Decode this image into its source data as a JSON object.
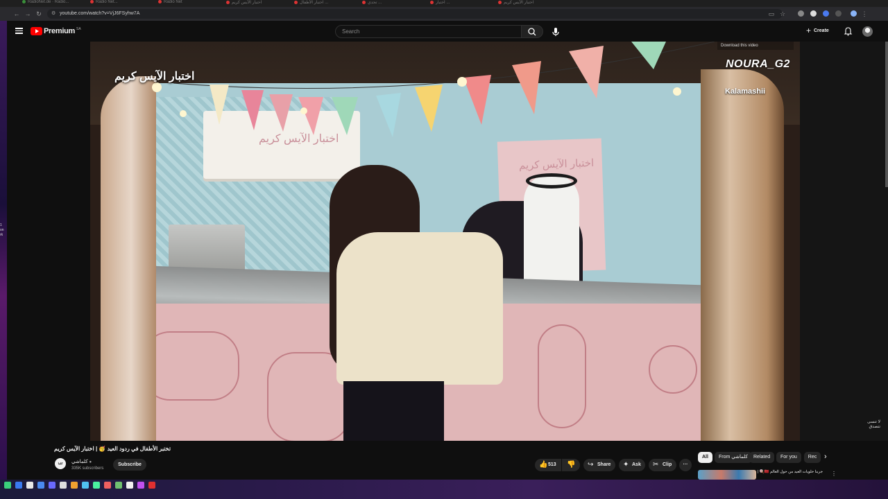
{
  "browser": {
    "url": "youtube.com/watch?v=VjJ6FSyhw7A",
    "tabs": [
      {
        "label": "RadioNet.de · Radio..."
      },
      {
        "label": "Radio Net..."
      },
      {
        "label": "Radio Net"
      },
      {
        "label": "اختبار الآيس كريم"
      },
      {
        "label": "اختبار الأطفال ..."
      },
      {
        "label": "تحدي ..."
      },
      {
        "label": "اختبار ..."
      },
      {
        "label": "اختبار الآيس كريم"
      }
    ]
  },
  "header": {
    "logo_text": "Premium",
    "country_code": "SA",
    "search_placeholder": "Search",
    "create_label": "Create"
  },
  "video": {
    "subtitle": "اختبار الآيس كريم",
    "download_hint": "Download this video",
    "watermark_name": "NOURA_G2",
    "channel_brand": "Kalamashii",
    "ac_text": "اختبار الآيس كريم",
    "sign_text": "اختبار الآيس كريم",
    "side_label": "لا تنسى تتصدق"
  },
  "meta": {
    "title": "تختبر الأطفال في ردود العيد 🥳 | اختبار الآيس كريم",
    "channel_name": "كلماشي",
    "subscribers": "335K subscribers",
    "subscribe_label": "Subscribe",
    "likes": "513",
    "share_label": "Share",
    "ask_label": "Ask",
    "clip_label": "Clip"
  },
  "chips": [
    {
      "label": "All",
      "active": true
    },
    {
      "label": "From كلماشي",
      "active": false
    },
    {
      "label": "Related",
      "active": false
    },
    {
      "label": "For you",
      "active": false
    },
    {
      "label": "Rec",
      "active": false
    }
  ],
  "recommendation": {
    "title": "جربنا حلويات العيد من حول العالم 🇲🇦🍭 |"
  },
  "desktop": {
    "strip_text": "1\non\nrk"
  }
}
